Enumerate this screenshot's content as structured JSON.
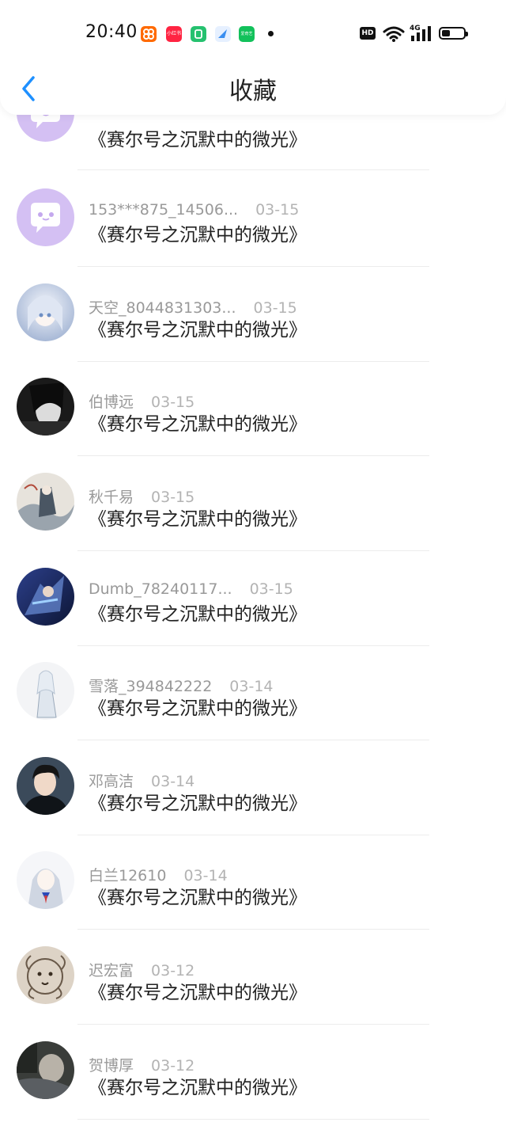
{
  "status_bar": {
    "time": "20:40",
    "app_icons": [
      {
        "name": "taobao-icon",
        "color": "#ff6a00",
        "label": ""
      },
      {
        "name": "xiaohongshu-icon",
        "color": "#ff2442",
        "label": "小红书"
      },
      {
        "name": "wechat-mini-icon",
        "color": "#25c16f",
        "label": ""
      },
      {
        "name": "blue-app-icon",
        "color": "#3a8ef0",
        "label": ""
      },
      {
        "name": "iqiyi-icon",
        "color": "#12c15b",
        "label": "爱奇艺"
      }
    ],
    "hd": "HD",
    "network": "4G"
  },
  "header": {
    "title": "收藏",
    "accent_color": "#1e90ff"
  },
  "items": [
    {
      "user": "",
      "date": "",
      "text": "《赛尔号之沉默中的微光》",
      "avatar": "purple-chat"
    },
    {
      "user": "153***875_14506...",
      "date": "03-15",
      "text": "《赛尔号之沉默中的微光》",
      "avatar": "purple-chat"
    },
    {
      "user": "天空_8044831303...",
      "date": "03-15",
      "text": "《赛尔号之沉默中的微光》",
      "avatar": "anime-white"
    },
    {
      "user": "伯博远",
      "date": "03-15",
      "text": "《赛尔号之沉默中的微光》",
      "avatar": "dark-figure"
    },
    {
      "user": "秋千易",
      "date": "03-15",
      "text": "《赛尔号之沉默中的微光》",
      "avatar": "ink-painting"
    },
    {
      "user": "Dumb_78240117...",
      "date": "03-15",
      "text": "《赛尔号之沉默中的微光》",
      "avatar": "blue-fantasy"
    },
    {
      "user": "雪落_394842222",
      "date": "03-14",
      "text": "《赛尔号之沉默中的微光》",
      "avatar": "white-sketch"
    },
    {
      "user": "邓高洁",
      "date": "03-14",
      "text": "《赛尔号之沉默中的微光》",
      "avatar": "young-man"
    },
    {
      "user": "白兰12610",
      "date": "03-14",
      "text": "《赛尔号之沉默中的微光》",
      "avatar": "anime-silver"
    },
    {
      "user": "迟宏富",
      "date": "03-12",
      "text": "《赛尔号之沉默中的微光》",
      "avatar": "lion-sketch"
    },
    {
      "user": "贺博厚",
      "date": "03-12",
      "text": "《赛尔号之沉默中的微光》",
      "avatar": "dim-photo"
    }
  ]
}
